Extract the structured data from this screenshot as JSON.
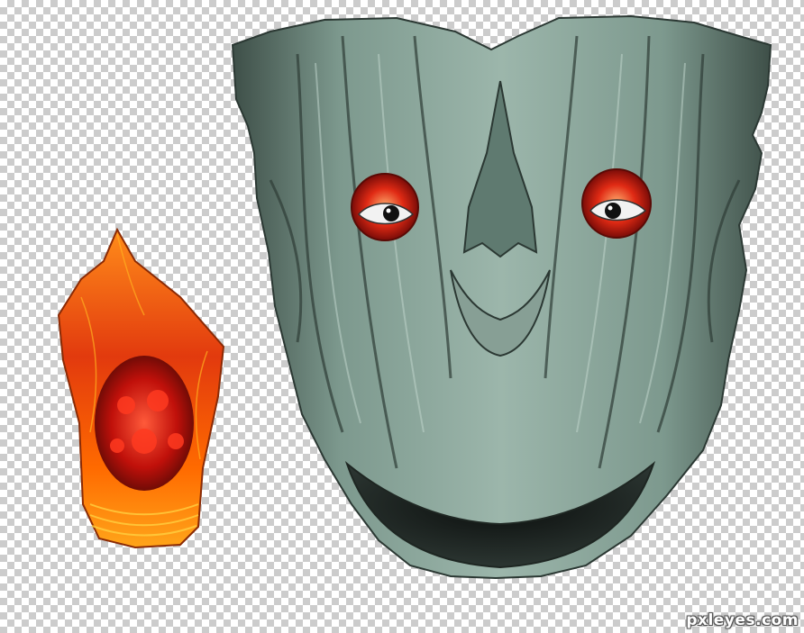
{
  "canvas": {
    "background": "transparency-checkerboard",
    "checker_light": "#ffffff",
    "checker_dark": "#cccccc"
  },
  "layers": [
    {
      "name": "stone-face",
      "colors": {
        "base": "#6f8a80",
        "highlight": "#a9c2b8",
        "shadow": "#2f3c37"
      }
    },
    {
      "name": "left-eye",
      "colors": {
        "iris": "#d01a12",
        "glow": "#ff6a2a",
        "white": "#f2f2f2",
        "pupil": "#111111"
      }
    },
    {
      "name": "right-eye",
      "colors": {
        "iris": "#d01a12",
        "glow": "#ff6a2a",
        "white": "#f2f2f2",
        "pupil": "#111111"
      }
    },
    {
      "name": "fractal-hat",
      "colors": {
        "outer": "#ff7a00",
        "inner": "#d8140c",
        "edge": "#c8d000"
      }
    }
  ],
  "watermark": {
    "text": "pxleyes.com"
  }
}
